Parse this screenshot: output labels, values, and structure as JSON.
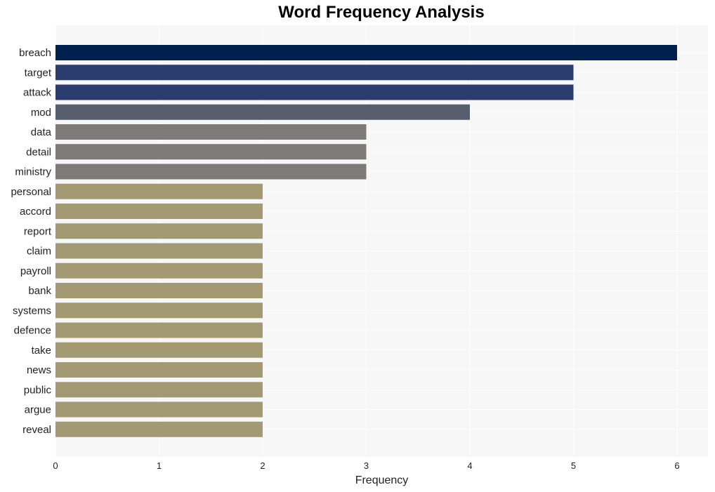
{
  "chart_data": {
    "type": "bar",
    "orientation": "horizontal",
    "title": "Word Frequency Analysis",
    "xlabel": "Frequency",
    "ylabel": "",
    "xlim": [
      0,
      6.3
    ],
    "xticks": [
      0,
      1,
      2,
      3,
      4,
      5,
      6
    ],
    "grid": true,
    "legend": "none",
    "categories": [
      "breach",
      "target",
      "attack",
      "mod",
      "data",
      "detail",
      "ministry",
      "personal",
      "accord",
      "report",
      "claim",
      "payroll",
      "bank",
      "systems",
      "defence",
      "take",
      "news",
      "public",
      "argue",
      "reveal"
    ],
    "values": [
      6,
      5,
      5,
      4,
      3,
      3,
      3,
      2,
      2,
      2,
      2,
      2,
      2,
      2,
      2,
      2,
      2,
      2,
      2,
      2
    ],
    "color_by_value": {
      "6": "#00204e",
      "5": "#2b3d6e",
      "4": "#575d6d",
      "3": "#7c7b78",
      "2": "#a39a74"
    },
    "plot_background": "#f7f7f7",
    "grid_color": "#ffffff"
  }
}
